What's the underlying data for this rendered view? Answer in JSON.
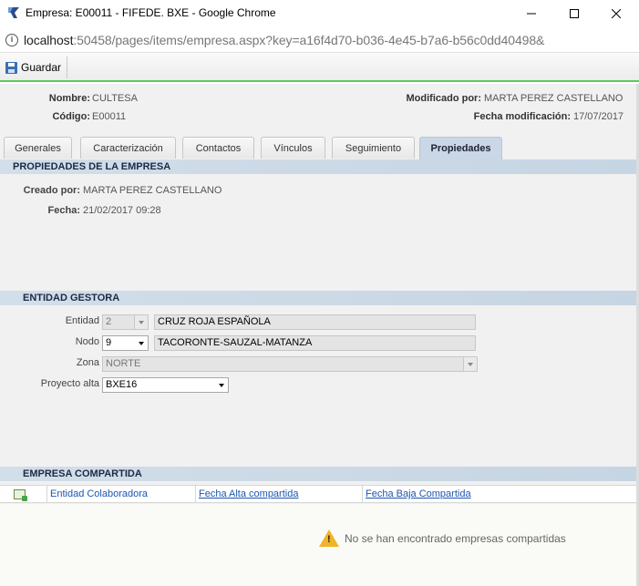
{
  "window": {
    "title": "Empresa: E00011 - FIFEDE. BXE - Google Chrome",
    "url_host": "localhost",
    "url_rest": ":50458/pages/items/empresa.aspx?key=a16f4d70-b036-4e45-b7a6-b56c0dd40498&"
  },
  "toolbar": {
    "save_label": "Guardar"
  },
  "header": {
    "nombre_label": "Nombre:",
    "nombre_value": "CULTESA",
    "codigo_label": "Código:",
    "codigo_value": "E00011",
    "modificado_label": "Modificado por:",
    "modificado_value": "MARTA PEREZ CASTELLANO",
    "fecha_mod_label": "Fecha modificación:",
    "fecha_mod_value": "17/07/2017"
  },
  "tabs": [
    {
      "label": "Generales"
    },
    {
      "label": "Caracterización"
    },
    {
      "label": "Contactos"
    },
    {
      "label": "Vínculos"
    },
    {
      "label": "Seguimiento"
    },
    {
      "label": "Propiedades",
      "active": true
    }
  ],
  "propiedades": {
    "title": "PROPIEDADES DE LA EMPRESA",
    "creado_label": "Creado por:",
    "creado_value": "MARTA PEREZ CASTELLANO",
    "fecha_label": "Fecha:",
    "fecha_value": "21/02/2017 09:28"
  },
  "entidad": {
    "title": "ENTIDAD GESTORA",
    "entidad_label": "Entidad",
    "entidad_code": "2",
    "entidad_name": "CRUZ ROJA ESPAÑOLA",
    "nodo_label": "Nodo",
    "nodo_code": "9",
    "nodo_name": "TACORONTE-SAUZAL-MATANZA",
    "zona_label": "Zona",
    "zona_value": "NORTE",
    "proyecto_label": "Proyecto alta",
    "proyecto_value": "BXE16"
  },
  "compartida": {
    "title": "EMPRESA COMPARTIDA",
    "columns": [
      "Entidad Colaboradora",
      "Fecha Alta compartida",
      "Fecha Baja Compartida"
    ],
    "empty_message": "No se han encontrado empresas compartidas"
  }
}
